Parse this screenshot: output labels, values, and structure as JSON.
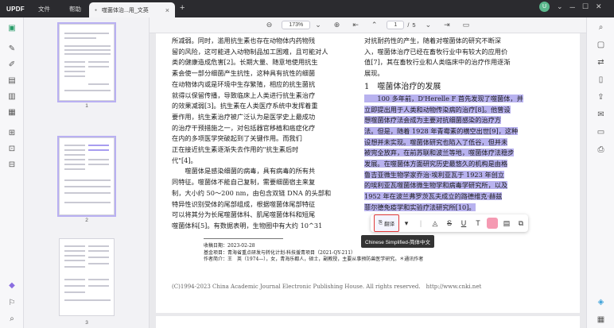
{
  "app": {
    "logo_main": "UPDF",
    "menu": [
      "文件",
      "帮助"
    ],
    "tab_title": "噬菌体治...用_文英",
    "user_initial": "U"
  },
  "toolbar": {
    "zoom": "173%",
    "page_current": "1",
    "page_sep": "/",
    "page_total": "5"
  },
  "thumbnails": [
    {
      "num": "1"
    },
    {
      "num": "2"
    },
    {
      "num": "3"
    }
  ],
  "doc": {
    "left_lines": [
      "所减弱。同时，滥用抗生素也存在动物体内药物残",
      "留的风险，这可能进入动物制品加工困难，且可能对人",
      "类的健康造成危害[2]。长期大量、随意地使用抗生",
      "素会使一部分细菌产生抗性，这种具有抗性的细菌",
      "在动物体内或是环境中生存繁殖，相应的抗生菌抗",
      "就得以保留传播，导致临床上人类进行抗生素治疗",
      "的效果减弱[3]。抗生素在人类医疗系统中发挥着重",
      "要作用，抗生素治疗被广泛认为是医学史上最成功",
      "的治疗干预措施之一，对包括器官移植和癌症化疗",
      "在内的多项医学突破起到了关键作用。而我们",
      "正在接近抗生素逐渐失去作用的\"抗生素后时",
      "代\"[4]。",
      "　　噬菌体是感染细菌的病毒，具有病毒的所有共",
      "同特征。噬菌体不能自己复制，需要细菌宿主来复",
      "制，大小约 50～200 nm，由包含双链 DNA 的头部和",
      "特异性识别受体的尾部组成，根据噬菌体尾部特征",
      "可以将其分为长尾噬菌体科、肌尾噬菌体科和短尾",
      "噬菌体科[5]。有数据表明，生物圈中有大约 10^31"
    ],
    "right_lines_top": [
      "对抗耐药性的产生，随着对噬菌体的研究不断深",
      "入，噬菌体治疗已经在畜牧行业中有较大的应用价",
      "值[7]，其在畜牧行业和人类临床中的治疗作用逐渐",
      "展现。"
    ],
    "section_heading": "1　噬菌体治疗的发展",
    "right_lines_hl": [
      "　　100 多年前，D'Herelle F 首先发现了噬菌体，并",
      "立即提出用于人类和动物传染病的治疗[8]。他曾设",
      "想噬菌体疗法会成为主要对抗细菌感染的治疗方",
      "法。但是，随着 1928 年青霉素的横空出世[9]，这种",
      "设想并未实现。噬菌体研究也陷入了低谷，但并未",
      "被完全放弃，在前苏联和波兰等地，噬菌体疗法稳步",
      "发展。在噬菌体方面研究历史最悠久的机构是由格",
      "鲁吉亚微生物学家乔治·埃利亚瓦于 1923 年创立",
      "的埃利亚瓦噬菌体微生物学和病毒学研究所，以及",
      "1952 年在波兰弗罗茨瓦夫成立的路德维克·赫兹",
      "菲尔德免疫学和实验疗法研究所[10]。"
    ],
    "footnotes": [
      "收稿日期：2023-02-28",
      "基金项目：青海省重点研发与转化计划-科技援青项目（2021-QY-211）",
      "作者简介：王　英（1974—），女，青海乐都人，硕士，副教授，主要从事预防兽医学研究。＊通讯作者"
    ],
    "copyright": "(C)1994-2023 China Academic Journal Electronic Publishing House. All rights reserved.　http://www.cnki.net"
  },
  "selection_toolbar": {
    "translate_label": "翻译",
    "tooltip": "Chinese Simplified-简体中文"
  },
  "colors": {
    "highlight": "#b8b2ef",
    "accent": "#2a9d6a",
    "translate_border": "#e23b3b"
  }
}
